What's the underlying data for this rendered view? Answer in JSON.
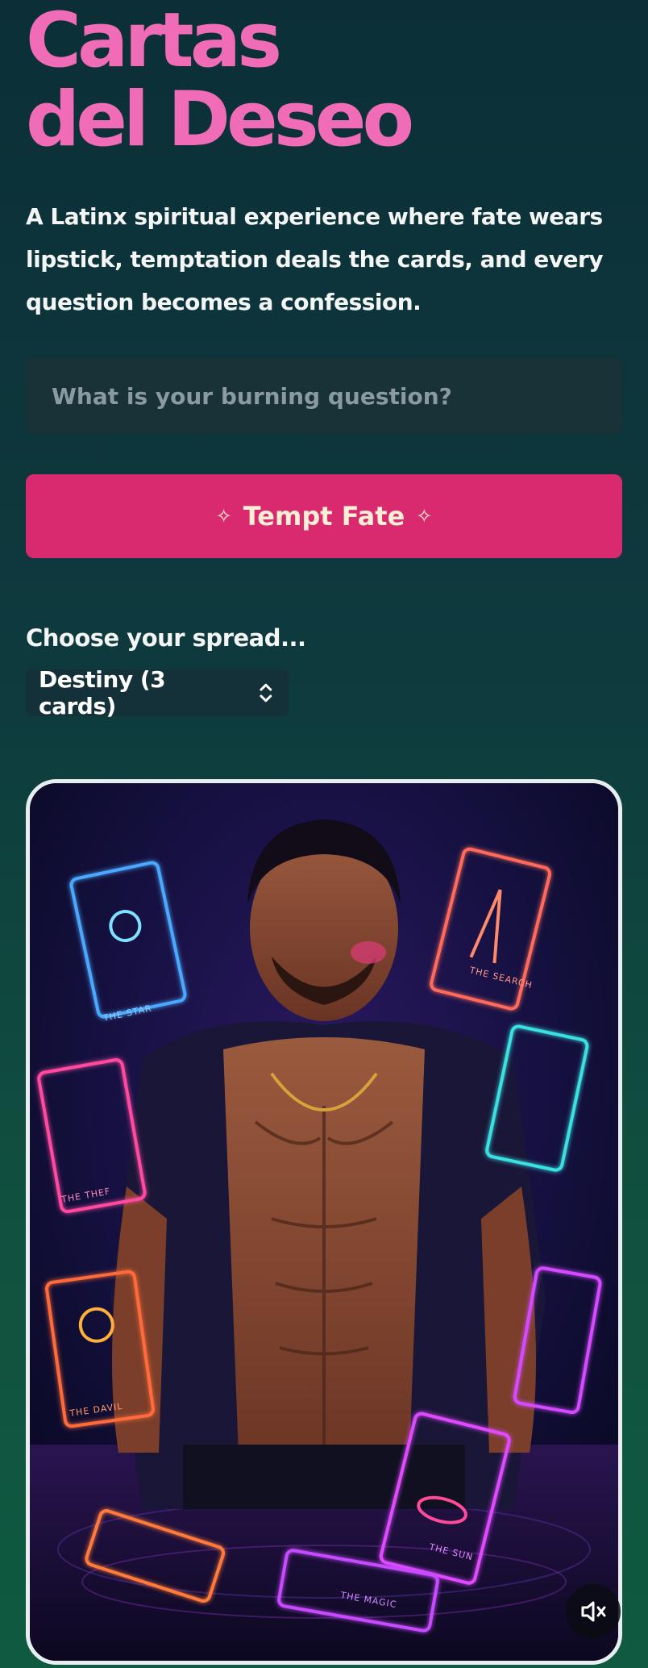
{
  "header": {
    "title_line1": "Cartas",
    "title_line2": "del Deseo",
    "tagline": "A Latinx spiritual experience where fate wears lipstick, temptation deals the cards, and every question becomes a confession."
  },
  "form": {
    "question_placeholder": "What is your burning question?",
    "question_value": "",
    "submit_label": "Tempt Fate",
    "sparkle_left": "✧",
    "sparkle_right": "✧"
  },
  "spread": {
    "label": "Choose your spread...",
    "selected": "Destiny (3 cards)"
  },
  "hero": {
    "card_captions": [
      "THE STAR",
      "THE SEARCH",
      "THE THEF",
      "THE DAVIL",
      "THE SUN",
      "THE MAGIC"
    ]
  },
  "colors": {
    "title": "#f06cb6",
    "button": "#da2a6f",
    "button_text": "#fdeed6",
    "input_bg": "#183238"
  },
  "icons": {
    "select_chevron": "chevron-up-down-icon",
    "mute": "speaker-mute-icon"
  }
}
